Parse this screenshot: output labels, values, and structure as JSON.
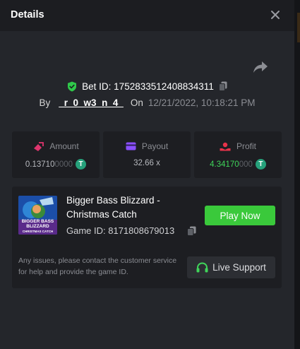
{
  "header": {
    "title": "Details",
    "close_icon": "close-icon"
  },
  "bet": {
    "bet_id_label": "Bet ID: 1752833512408834311",
    "by_label": "By",
    "username": "_r_0_w3_n_4_",
    "on_label": "On",
    "datetime": "12/21/2022, 10:18:21 PM"
  },
  "stats": {
    "amount": {
      "label": "Amount",
      "value_main": "0.13710",
      "value_dim": "0000",
      "coin": "T",
      "icon": "amount-icon"
    },
    "payout": {
      "label": "Payout",
      "value": "32.66 x",
      "icon": "wallet-icon"
    },
    "profit": {
      "label": "Profit",
      "value_main": "4.34170",
      "value_dim": "000",
      "coin": "T",
      "icon": "profit-icon"
    }
  },
  "game": {
    "title": "Bigger Bass Blizzard - Christmas Catch",
    "game_id": "Game ID: 8171808679013",
    "play_label": "Play Now",
    "thumb_text": [
      "BIGGER BASS",
      "BLIZZARD",
      "CHRISTMAS CATCH"
    ]
  },
  "support": {
    "note": "Any issues, please contact the customer service for help and provide the game ID.",
    "button_label": "Live Support"
  },
  "colors": {
    "background": "#24262b",
    "header": "#1c1d21",
    "card": "#1d1e22",
    "accent_green": "#3ac93b",
    "profit_green": "#3fd45a",
    "tether": "#26a17b",
    "amount_icon": "#e0356e",
    "wallet_icon": "#8a4fff",
    "profit_icon": "#e8334a"
  }
}
